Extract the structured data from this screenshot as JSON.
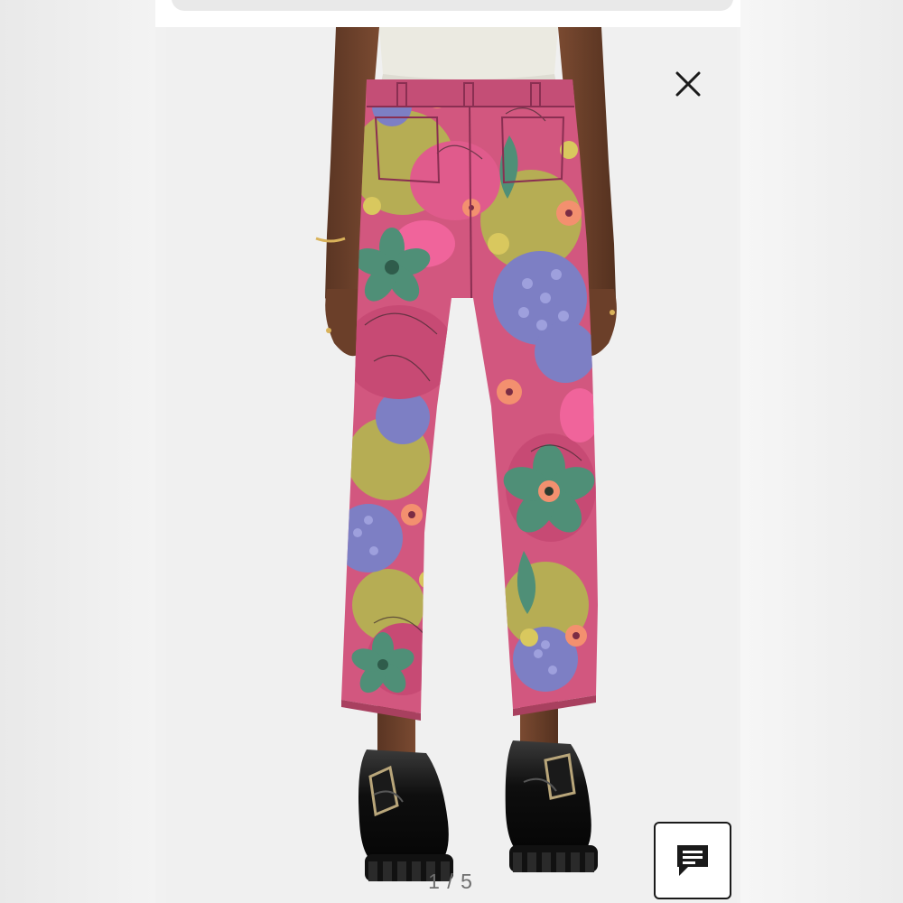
{
  "gallery": {
    "current_index": "1",
    "separator": "/",
    "total": "5"
  },
  "icons": {
    "close": "close-icon",
    "chat": "chat-icon"
  },
  "product": {
    "print_colors": [
      "#d2577f",
      "#f0649b",
      "#4f8f77",
      "#7d7fc4",
      "#b6ad54",
      "#f3906f"
    ]
  }
}
